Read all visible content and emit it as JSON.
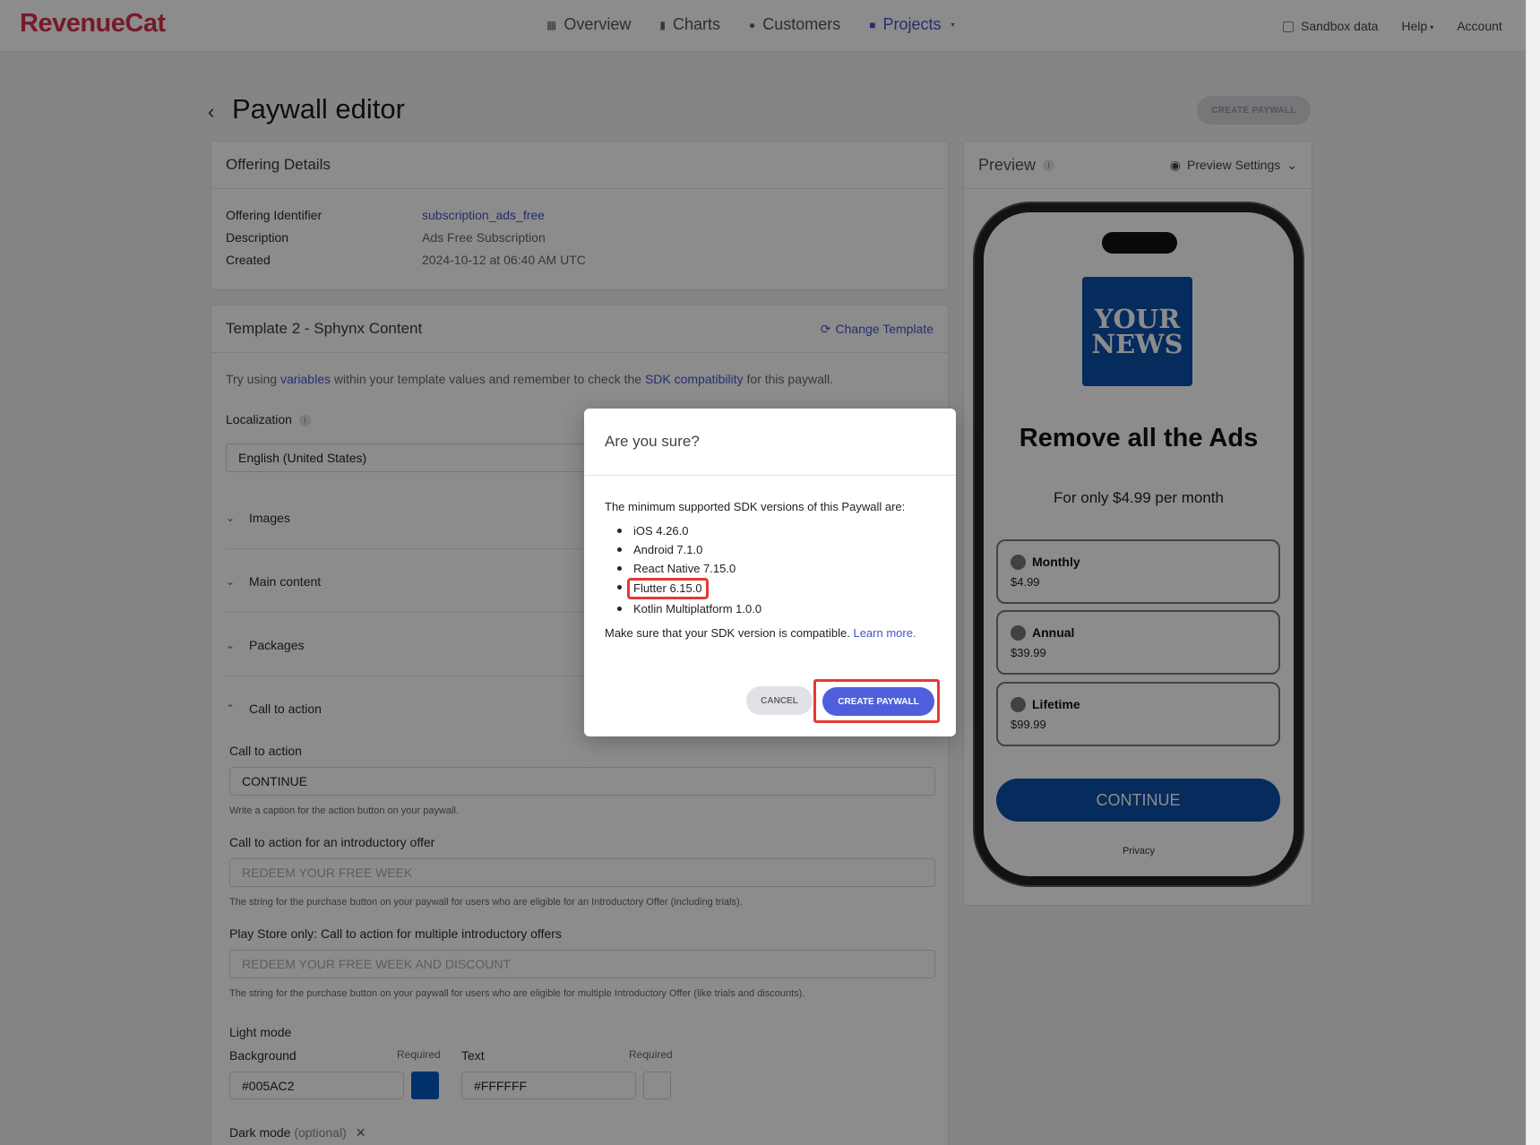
{
  "nav": {
    "logo": "RevenueCat",
    "items": [
      {
        "label": "Overview",
        "icon": "grid-icon"
      },
      {
        "label": "Charts",
        "icon": "bar-chart-icon"
      },
      {
        "label": "Customers",
        "icon": "person-icon"
      },
      {
        "label": "Projects",
        "icon": "folder-icon"
      }
    ],
    "sandbox": "Sandbox data",
    "help": "Help",
    "account": "Account"
  },
  "page": {
    "title": "Paywall editor",
    "create_button": "CREATE PAYWALL"
  },
  "offering": {
    "header": "Offering Details",
    "rows": [
      {
        "key": "Offering Identifier",
        "value": "subscription_ads_free"
      },
      {
        "key": "Description",
        "value": "Ads Free Subscription"
      },
      {
        "key": "Created",
        "value": "2024-10-12 at 06:40 AM UTC"
      }
    ]
  },
  "template": {
    "header": "Template 2 - Sphynx Content",
    "change_link": "Change Template",
    "hint_prefix": "Try using ",
    "hint_link1": "variables",
    "hint_middle": " within your template values and remember to check the ",
    "hint_link2": "SDK compatibility",
    "hint_suffix": " for this paywall.",
    "localization_label": "Localization",
    "localization_value": "English (United States)",
    "sections": [
      "Images",
      "Main content",
      "Packages",
      "Call to action"
    ],
    "cta_label": "Call to action",
    "cta_value": "CONTINUE",
    "cta_hint": "Write a caption for the action button on your paywall.",
    "intro_label": "Call to action for an introductory offer",
    "intro_placeholder": "REDEEM YOUR FREE WEEK",
    "intro_hint": "The string for the purchase button on your paywall for users who are eligible for an Introductory Offer (including trials).",
    "multi_label": "Play Store only: Call to action for multiple introductory offers",
    "multi_placeholder": "REDEEM YOUR FREE WEEK AND DISCOUNT",
    "multi_hint": "The string for the purchase button on your paywall for users who are eligible for multiple Introductory Offer (like trials and discounts).",
    "light_mode": "Light mode",
    "background_label": "Background",
    "background_value": "#005AC2",
    "text_label": "Text",
    "text_value": "#FFFFFF",
    "required": "Required",
    "dark_mode": "Dark mode",
    "optional": "(optional)"
  },
  "preview": {
    "header": "Preview",
    "settings": "Preview Settings",
    "logo_line1": "YOUR",
    "logo_line2": "NEWS",
    "title": "Remove all the Ads",
    "subtitle": "For only $4.99 per month",
    "packages": [
      {
        "name": "Monthly",
        "price": "$4.99"
      },
      {
        "name": "Annual",
        "price": "$39.99"
      },
      {
        "name": "Lifetime",
        "price": "$99.99"
      }
    ],
    "cta": "CONTINUE",
    "privacy": "Privacy",
    "brand_color": "#0b4fa9"
  },
  "modal": {
    "title": "Are you sure?",
    "intro": "The minimum supported SDK versions of this Paywall are:",
    "versions": [
      "iOS 4.26.0",
      "Android 7.1.0",
      "React Native 7.15.0",
      "Flutter 6.15.0",
      "Kotlin Multiplatform 1.0.0"
    ],
    "note": "Make sure that your SDK version is compatible.",
    "learn_more": "Learn more.",
    "cancel": "CANCEL",
    "create": "CREATE PAYWALL"
  }
}
